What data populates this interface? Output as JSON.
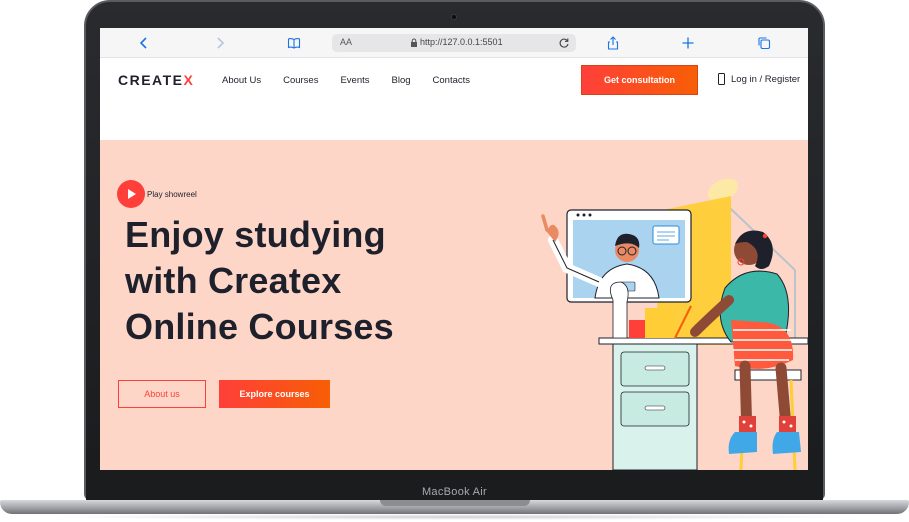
{
  "device": {
    "model_label": "MacBook Air"
  },
  "browser": {
    "address_prefix": "AA",
    "url": "http://127.0.0.1:5501"
  },
  "header": {
    "logo_text": "CREATE",
    "logo_mark": "X",
    "nav": [
      "About Us",
      "Courses",
      "Events",
      "Blog",
      "Contacts"
    ],
    "cta_label": "Get consultation",
    "login_label": "Log in / Register"
  },
  "hero": {
    "play_label": "Play showreel",
    "title_lines": [
      "Enjoy studying",
      "with Createx",
      "Online Courses"
    ],
    "about_button": "About us",
    "explore_button": "Explore courses"
  },
  "colors": {
    "accent": "#ff3f3a",
    "accent_gradient_end": "#f75e05",
    "hero_bg": "#fed6c8",
    "text_dark": "#1e212c"
  },
  "icons": {
    "browser_back": "chevron-left-icon",
    "browser_forward": "chevron-right-icon",
    "bookmarks": "book-icon",
    "lock": "lock-icon",
    "reload": "reload-icon",
    "share": "share-icon",
    "new_tab": "plus-icon",
    "tabs": "tabs-icon",
    "phone": "phone-icon",
    "play": "play-icon"
  }
}
